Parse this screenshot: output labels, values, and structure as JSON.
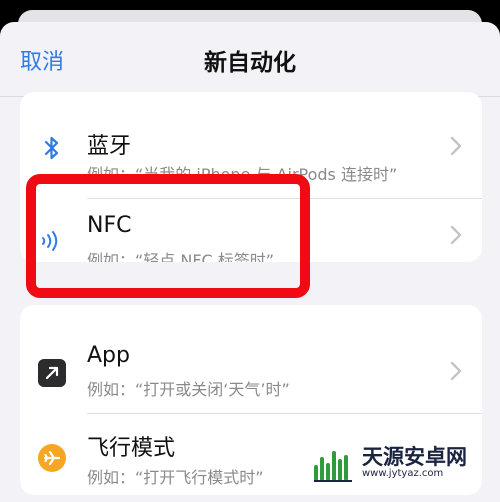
{
  "nav": {
    "cancel_label": "取消",
    "title": "新自动化"
  },
  "sections": [
    {
      "items": [
        {
          "icon": "bluetooth-icon",
          "title": "蓝牙",
          "subtitle": "例如：“当我的 iPhone 与 AirPods 连接时”"
        },
        {
          "icon": "nfc-icon",
          "title": "NFC",
          "subtitle": "例如：“轻点 NFC 标签时”"
        }
      ]
    },
    {
      "items": [
        {
          "icon": "app-open-icon",
          "title": "App",
          "subtitle": "例如：“打开或关闭‘天气’时”"
        },
        {
          "icon": "airplane-icon",
          "title": "飞行模式",
          "subtitle": "例如：“打开飞行模式时”"
        }
      ]
    }
  ],
  "highlight": {
    "target": "NFC",
    "color": "#ef0a14"
  },
  "watermark": {
    "text": "天源安卓网",
    "url": "www.jytyaz.com"
  },
  "colors": {
    "accent": "#2f7be6",
    "background": "#f2f2f7",
    "card": "#ffffff",
    "watermark": "#1a2440"
  }
}
